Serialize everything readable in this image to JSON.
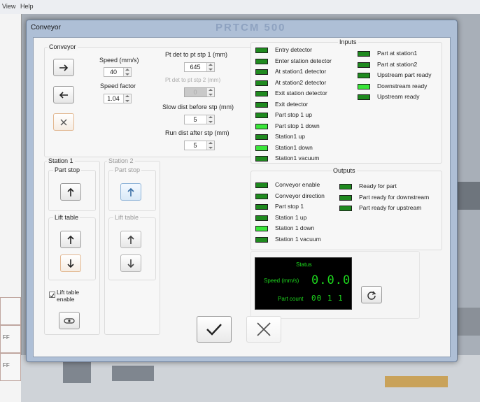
{
  "menubar": {
    "items": [
      "View",
      "Help"
    ]
  },
  "background": {
    "watermark": "PRTCM 500",
    "side_buttons": [
      "FF",
      "FF"
    ]
  },
  "dialog": {
    "title": "Conveyor",
    "conveyor_group": {
      "legend": "Conveyor",
      "speed_label": "Speed (mm/s)",
      "speed_value": "40",
      "speed_factor_label": "Speed factor",
      "speed_factor_value": "1.04",
      "pt_det_1_label": "Pt det to pt stp 1 (mm)",
      "pt_det_1_value": "645",
      "pt_det_2_label": "Pt det to pt stp 2 (mm)",
      "pt_det_2_value": "0",
      "slow_dist_label": "Slow dist before stp (mm)",
      "slow_dist_value": "5",
      "run_dist_label": "Run dist after stp (mm)",
      "run_dist_value": "5"
    },
    "inputs": {
      "legend": "Inputs",
      "left": [
        {
          "label": "Entry detector",
          "state": "on"
        },
        {
          "label": "Enter station detector",
          "state": "on"
        },
        {
          "label": "At station1 detector",
          "state": "on"
        },
        {
          "label": "At station2 detector",
          "state": "on"
        },
        {
          "label": "Exit station detector",
          "state": "on"
        },
        {
          "label": "Exit detector",
          "state": "on"
        },
        {
          "label": "Part stop 1 up",
          "state": "on"
        },
        {
          "label": "Part stop 1 down",
          "state": "bright"
        },
        {
          "label": "Station1 up",
          "state": "on"
        },
        {
          "label": "Station1 down",
          "state": "bright"
        },
        {
          "label": "Station1 vacuum",
          "state": "on"
        }
      ],
      "right": [
        {
          "label": "Part at station1",
          "state": "on"
        },
        {
          "label": "Part at station2",
          "state": "on"
        },
        {
          "label": "Upstream part ready",
          "state": "on"
        },
        {
          "label": "Downstream ready",
          "state": "bright"
        },
        {
          "label": "Upstream ready",
          "state": "on"
        }
      ]
    },
    "outputs": {
      "legend": "Outputs",
      "left": [
        {
          "label": "Conveyor enable",
          "state": "on"
        },
        {
          "label": "Conveyor direction",
          "state": "on"
        },
        {
          "label": "Part stop 1",
          "state": "on"
        },
        {
          "label": "Station 1 up",
          "state": "on"
        },
        {
          "label": "Station 1 down",
          "state": "bright"
        },
        {
          "label": "Station 1 vacuum",
          "state": "on"
        }
      ],
      "right": [
        {
          "label": "Ready for part",
          "state": "on"
        },
        {
          "label": "Part ready for downstream",
          "state": "on"
        },
        {
          "label": "Part ready for upstream",
          "state": "on"
        }
      ]
    },
    "station1": {
      "legend": "Station 1",
      "part_stop": "Part stop",
      "lift_table": "Lift table",
      "lift_enable": "Lift table enable"
    },
    "station2": {
      "legend": "Station 2",
      "part_stop": "Part stop",
      "lift_table": "Lift table"
    },
    "status": {
      "title": "Status",
      "speed_label": "Speed (mm/s)",
      "speed_value": "0.0.0",
      "part_count_label": "Part count",
      "part_count_value": "00 1 1"
    }
  },
  "colors": {
    "led_on": "#1f8a1f",
    "led_bright": "#39e539",
    "status_green": "#1dd61d"
  }
}
